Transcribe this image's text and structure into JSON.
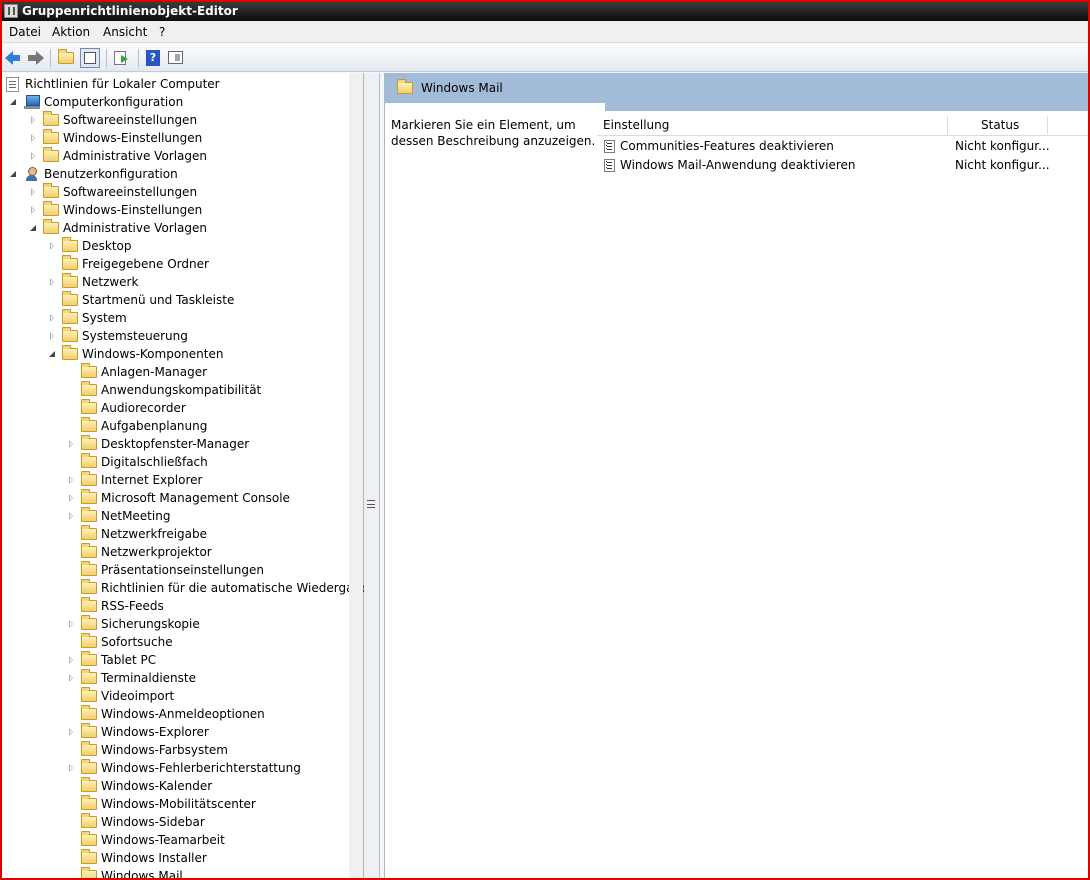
{
  "window": {
    "title": "Gruppenrichtlinienobjekt-Editor"
  },
  "menu": {
    "items": [
      "Datei",
      "Aktion",
      "Ansicht",
      "?"
    ]
  },
  "toolbar": {
    "icons": [
      "back-arrow-icon",
      "forward-arrow-icon",
      "up-folder-icon",
      "show-hide-tree-icon",
      "export-list-icon",
      "help-icon",
      "show-hide-action-pane-icon"
    ]
  },
  "tree": {
    "root": "Richtlinien für Lokaler Computer",
    "computer": {
      "label": "Computerkonfiguration",
      "children": [
        "Softwareeinstellungen",
        "Windows-Einstellungen",
        "Administrative Vorlagen"
      ]
    },
    "user": {
      "label": "Benutzerkonfiguration",
      "software": "Softwareeinstellungen",
      "windows_settings": "Windows-Einstellungen",
      "admin_templates": "Administrative Vorlagen",
      "admin_children": [
        "Desktop",
        "Freigegebene Ordner",
        "Netzwerk",
        "Startmenü und Taskleiste",
        "System",
        "Systemsteuerung",
        "Windows-Komponenten"
      ],
      "components": [
        "Anlagen-Manager",
        "Anwendungskompatibilität",
        "Audiorecorder",
        "Aufgabenplanung",
        "Desktopfenster-Manager",
        "Digitalschließfach",
        "Internet Explorer",
        "Microsoft Management Console",
        "NetMeeting",
        "Netzwerkfreigabe",
        "Netzwerkprojektor",
        "Präsentationseinstellungen",
        "Richtlinien für die automatische Wiedergabe",
        "RSS-Feeds",
        "Sicherungskopie",
        "Sofortsuche",
        "Tablet PC",
        "Terminaldienste",
        "Videoimport",
        "Windows-Anmeldeoptionen",
        "Windows-Explorer",
        "Windows-Farbsystem",
        "Windows-Fehlerberichterstattung",
        "Windows-Kalender",
        "Windows-Mobilitätscenter",
        "Windows-Sidebar",
        "Windows-Teamarbeit",
        "Windows Installer",
        "Windows Mail"
      ]
    }
  },
  "detail": {
    "title": "Windows Mail",
    "description": "Markieren Sie ein Element, um dessen Beschreibung anzuzeigen.",
    "columns": [
      "Einstellung",
      "Status"
    ],
    "rows": [
      {
        "setting": "Communities-Features deaktivieren",
        "status": "Nicht konfigur..."
      },
      {
        "setting": "Windows Mail-Anwendung deaktivieren",
        "status": "Nicht konfigur..."
      }
    ]
  }
}
